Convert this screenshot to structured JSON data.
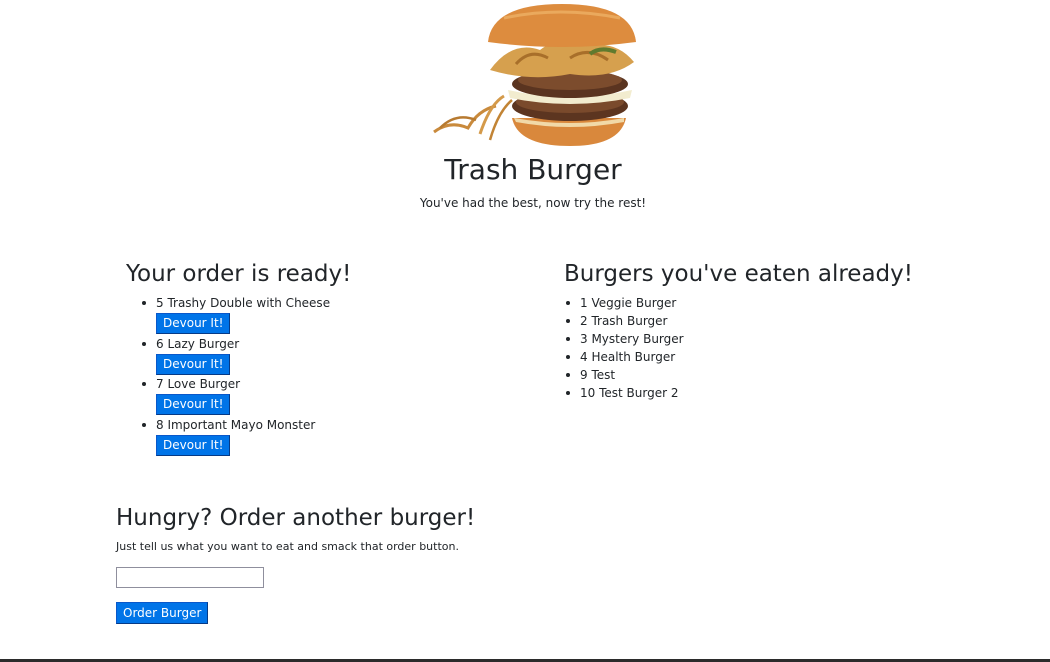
{
  "header": {
    "title": "Trash Burger",
    "tagline": "You've had the best, now try the rest!"
  },
  "orders": {
    "heading": "Your order is ready!",
    "devour_label": "Devour It!",
    "items": [
      {
        "label": "5 Trashy Double with Cheese"
      },
      {
        "label": "6 Lazy Burger"
      },
      {
        "label": "7 Love Burger"
      },
      {
        "label": "8 Important Mayo Monster"
      }
    ]
  },
  "eaten": {
    "heading": "Burgers you've eaten already!",
    "items": [
      {
        "label": "1 Veggie Burger"
      },
      {
        "label": "2 Trash Burger"
      },
      {
        "label": "3 Mystery Burger"
      },
      {
        "label": "4 Health Burger"
      },
      {
        "label": "9 Test"
      },
      {
        "label": "10 Test Burger 2"
      }
    ]
  },
  "order_form": {
    "heading": "Hungry? Order another burger!",
    "subtext": "Just tell us what you want to eat and smack that order button.",
    "input_value": "",
    "button_label": "Order Burger"
  },
  "colors": {
    "button_bg": "#0074e8",
    "text": "#212529"
  }
}
